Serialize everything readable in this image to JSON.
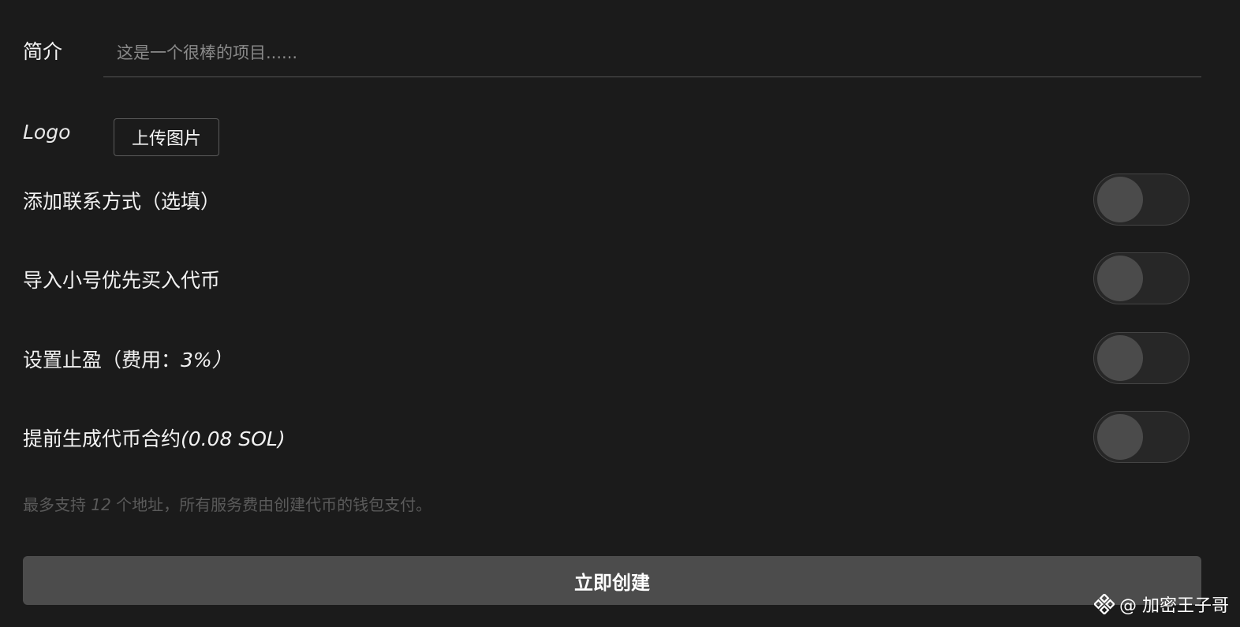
{
  "form": {
    "description": {
      "label": "简介",
      "placeholder": "这是一个很棒的项目......",
      "value": ""
    },
    "logo": {
      "label": "Logo",
      "upload_label": "上传图片"
    },
    "options": [
      {
        "label_main": "添加联系方式（选填）",
        "label_extra": "",
        "enabled": false
      },
      {
        "label_main": "导入小号优先买入代币",
        "label_extra": "",
        "enabled": false
      },
      {
        "label_main": "设置止盈（费用：",
        "label_extra": "3%）",
        "enabled": false
      },
      {
        "label_main": "提前生成代币合约",
        "label_extra": "(0.08 SOL)",
        "enabled": false
      }
    ],
    "note": {
      "prefix": "最多支持 ",
      "count": "12",
      "suffix": " 个地址，所有服务费由创建代币的钱包支付。"
    },
    "submit_label": "立即创建"
  },
  "watermark": {
    "text": "@ 加密王子哥",
    "icon": "binance-logo-icon"
  },
  "colors": {
    "background": "#1b1b1b",
    "toggle_track": "#272727",
    "toggle_knob": "#4b4b4b",
    "button_bg": "#4c4c4c",
    "note_text": "#5a5a5a"
  }
}
